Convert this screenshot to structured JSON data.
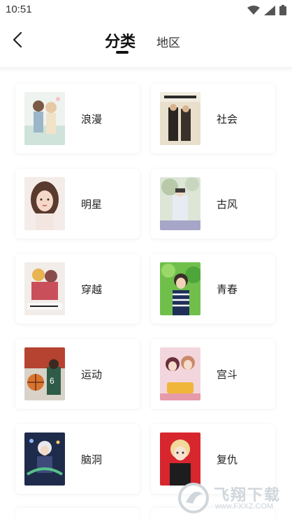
{
  "status_bar": {
    "time": "10:51"
  },
  "header": {
    "tabs": [
      {
        "label": "分类",
        "active": true
      },
      {
        "label": "地区",
        "active": false
      }
    ]
  },
  "categories": [
    {
      "label": "浪漫"
    },
    {
      "label": "社会"
    },
    {
      "label": "明星"
    },
    {
      "label": "古风"
    },
    {
      "label": "穿越"
    },
    {
      "label": "青春"
    },
    {
      "label": "运动"
    },
    {
      "label": "宫斗"
    },
    {
      "label": "脑洞"
    },
    {
      "label": "复仇"
    }
  ],
  "watermark": {
    "name": "飞翔下载",
    "url": "www.FXXZ.COM"
  },
  "colors": {
    "accent": "#111111",
    "background": "#ffffff",
    "watermark": "#cfd6dc"
  }
}
